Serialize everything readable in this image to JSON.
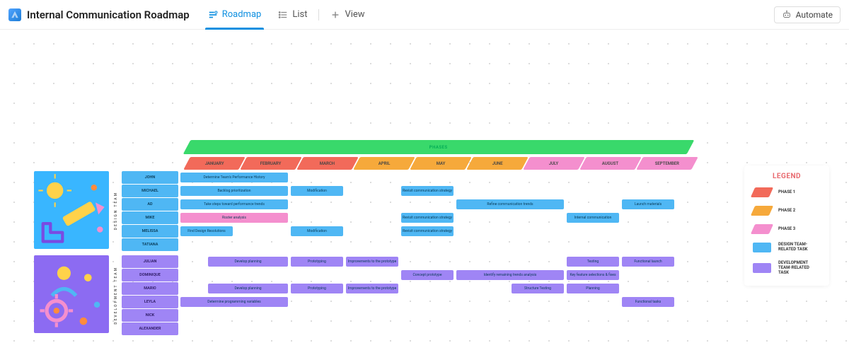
{
  "header": {
    "title": "Internal Communication Roadmap",
    "tabs": {
      "roadmap": "Roadmap",
      "list": "List",
      "view": "View"
    },
    "automate": "Automate"
  },
  "phases_band": "PHASES",
  "months": [
    "JANUARY",
    "FEBRUARY",
    "MARCH",
    "APRIL",
    "MAY",
    "JUNE",
    "JULY",
    "AUGUST",
    "SEPTEMBER"
  ],
  "team_labels": {
    "design": "DESIGN TEAM",
    "dev": "DEVELOPMENT TEAM"
  },
  "design_rows": [
    {
      "name": "JOHN",
      "segs": [
        {
          "text": "Determine Team's Performance History",
          "start": 0,
          "span": 2,
          "cls": "c-blue"
        }
      ]
    },
    {
      "name": "MICHAEL",
      "segs": [
        {
          "text": "Backlog prioritization",
          "start": 0,
          "span": 2,
          "cls": "c-blue"
        },
        {
          "text": "Modification",
          "start": 2,
          "span": 1,
          "cls": "c-blue"
        },
        {
          "text": "Revisit communication strategy",
          "start": 4,
          "span": 1,
          "cls": "c-blue"
        }
      ]
    },
    {
      "name": "AD",
      "segs": [
        {
          "text": "Take steps toward performance trends",
          "start": 0,
          "span": 2,
          "cls": "c-blue"
        },
        {
          "text": "Refine communication trends",
          "start": 5,
          "span": 2,
          "cls": "c-blue"
        },
        {
          "text": "Launch materials",
          "start": 8,
          "span": 1,
          "cls": "c-blue"
        }
      ]
    },
    {
      "name": "MIKE",
      "segs": [
        {
          "text": "Roster analysis",
          "start": 0,
          "span": 2,
          "cls": "c-pnk"
        },
        {
          "text": "Revisit communication strategy",
          "start": 4,
          "span": 1,
          "cls": "c-blue"
        },
        {
          "text": "Internal communication",
          "start": 7,
          "span": 1,
          "cls": "c-blue"
        }
      ]
    },
    {
      "name": "MELISSA",
      "segs": [
        {
          "text": "Find Design Resolutions",
          "start": 0,
          "span": 1,
          "cls": "c-blue"
        },
        {
          "text": "Modification",
          "start": 2,
          "span": 1,
          "cls": "c-blue"
        },
        {
          "text": "Revisit communication strategy",
          "start": 4,
          "span": 1,
          "cls": "c-blue"
        }
      ]
    },
    {
      "name": "TATIANA",
      "segs": []
    }
  ],
  "dev_rows": [
    {
      "name": "JULIAN",
      "segs": [
        {
          "text": "Develop planning",
          "start": 0.5,
          "span": 1.5,
          "cls": "c-pur"
        },
        {
          "text": "Prototyping",
          "start": 2,
          "span": 1,
          "cls": "c-pur"
        },
        {
          "text": "Improvements to the prototype",
          "start": 3,
          "span": 1,
          "cls": "c-pur"
        },
        {
          "text": "Testing",
          "start": 7,
          "span": 1,
          "cls": "c-pur"
        },
        {
          "text": "Functional launch",
          "start": 8,
          "span": 1,
          "cls": "c-pur"
        }
      ]
    },
    {
      "name": "DOMINIQUE",
      "segs": [
        {
          "text": "Concept prototype",
          "start": 4,
          "span": 1,
          "cls": "c-pur"
        },
        {
          "text": "Identify remaining trends analysis",
          "start": 5,
          "span": 2,
          "cls": "c-pur"
        },
        {
          "text": "Key feature selections & fixes",
          "start": 7,
          "span": 1,
          "cls": "c-pur"
        }
      ]
    },
    {
      "name": "MARIO",
      "segs": [
        {
          "text": "Develop planning",
          "start": 0.5,
          "span": 1.5,
          "cls": "c-pur"
        },
        {
          "text": "Prototyping",
          "start": 2,
          "span": 1,
          "cls": "c-pur"
        },
        {
          "text": "Improvements to the prototype",
          "start": 3,
          "span": 1,
          "cls": "c-pur"
        },
        {
          "text": "Structure Testing",
          "start": 6,
          "span": 1,
          "cls": "c-pur"
        },
        {
          "text": "Planning",
          "start": 7,
          "span": 1,
          "cls": "c-pur"
        }
      ]
    },
    {
      "name": "LEYLA",
      "segs": [
        {
          "text": "Determine programming variables",
          "start": 0,
          "span": 2,
          "cls": "c-pur"
        },
        {
          "text": "Functional tasks",
          "start": 8,
          "span": 1,
          "cls": "c-pur"
        }
      ]
    },
    {
      "name": "NICK",
      "segs": []
    },
    {
      "name": "ALEXANDER",
      "segs": []
    }
  ],
  "legend": {
    "title": "LEGEND",
    "items": {
      "p1": "PHASE 1",
      "p2": "PHASE 2",
      "p3": "PHASE 3",
      "d": "DESIGN TEAM-RELATED TASK",
      "v": "DEVELOPMENT TEAM-RELATED TASK"
    }
  }
}
